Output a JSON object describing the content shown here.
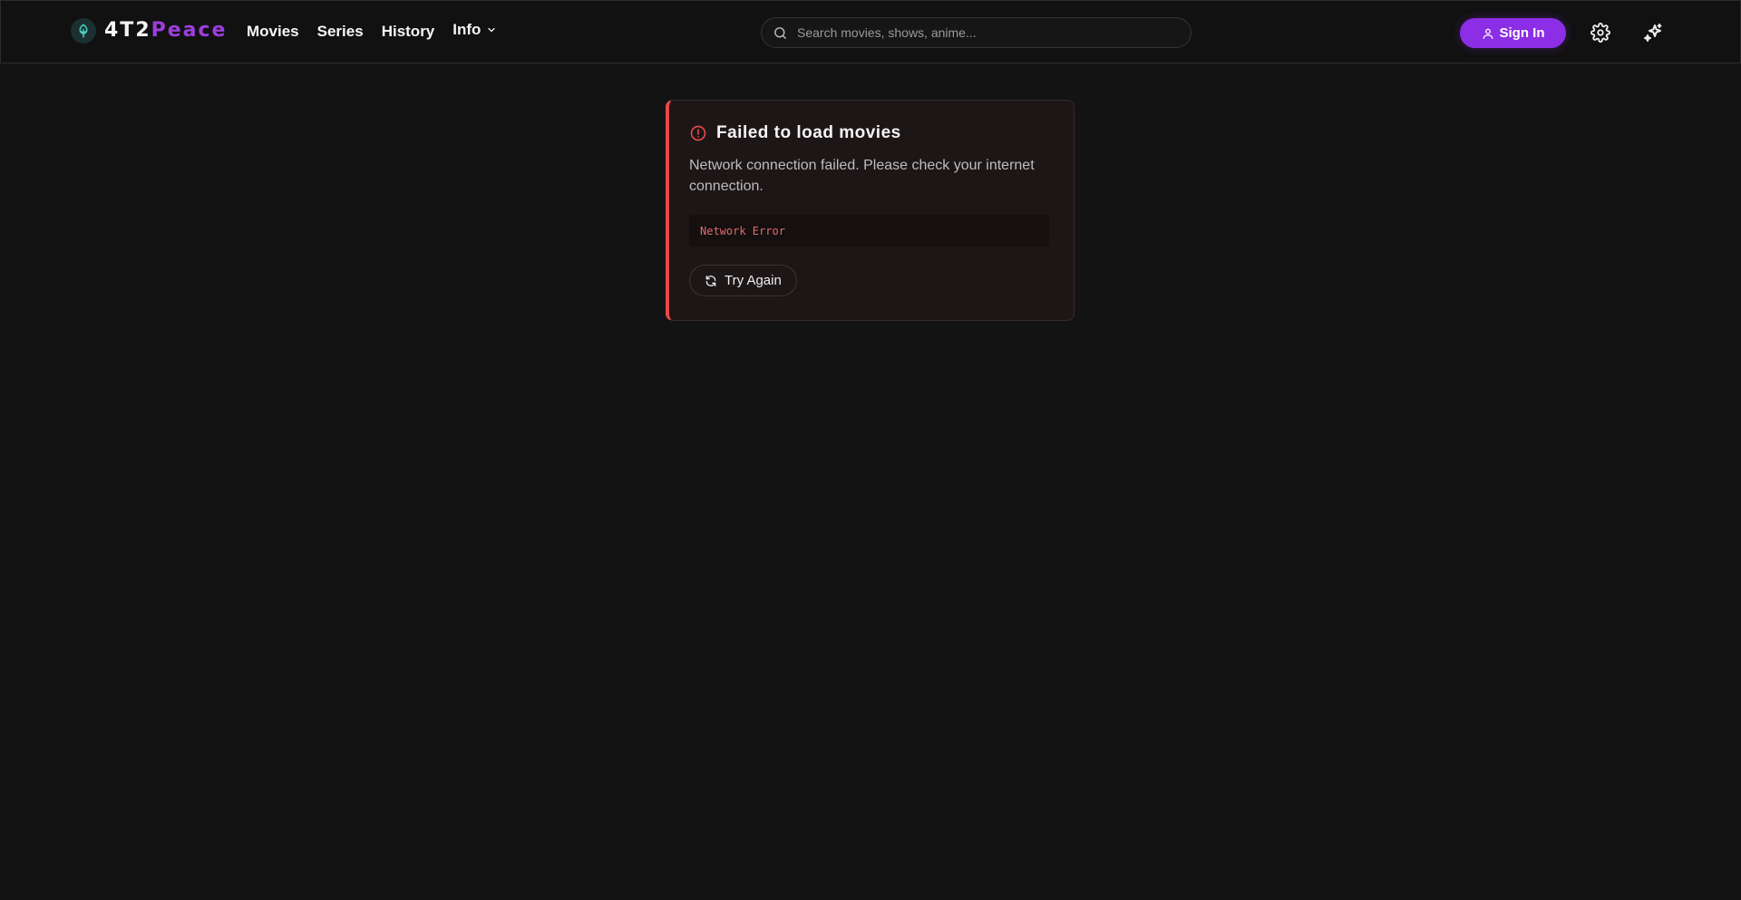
{
  "header": {
    "brand": {
      "part_a": "4T2",
      "part_b": "Peace",
      "logo_icon": "shield-emblem-icon"
    },
    "nav": [
      {
        "label": "Movies"
      },
      {
        "label": "Series"
      },
      {
        "label": "History"
      },
      {
        "label": "Info",
        "icon": "chevron-down-icon"
      }
    ],
    "search": {
      "placeholder": "Search movies, shows, anime...",
      "value": "",
      "icon": "search-icon"
    },
    "sign_in": {
      "label": "Sign In",
      "icon": "user-icon"
    },
    "settings_icon": "gear-icon",
    "theme_icon": "sparkles-icon"
  },
  "error": {
    "icon": "alert-circle-icon",
    "title": "Failed to load movies",
    "message": "Network connection failed. Please check your internet connection.",
    "code": "Network Error",
    "retry": {
      "label": "Try Again",
      "icon": "refresh-icon"
    }
  },
  "colors": {
    "background": "#131313",
    "accent": "#8c2ee6",
    "brand_secondary": "#9b3fdc",
    "error": "#e84848"
  }
}
